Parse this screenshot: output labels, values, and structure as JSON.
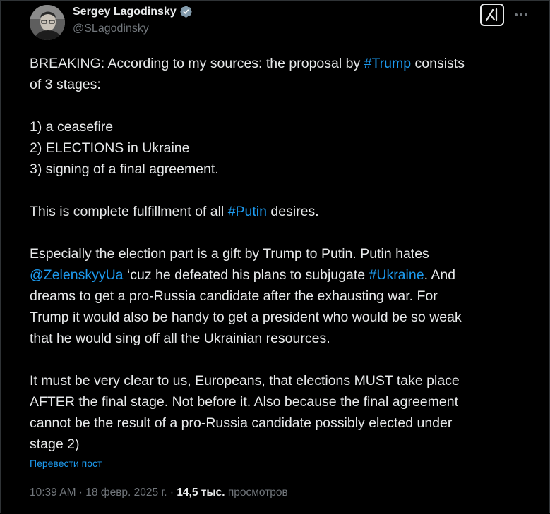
{
  "author": {
    "name": "Sergey Lagodinsky",
    "handle": "@SLagodinsky",
    "verified": true,
    "avatar_icon": "profile-photo"
  },
  "actions": {
    "grok_icon": "grok-icon",
    "more_icon": "more-horizontal-icon"
  },
  "tweet": {
    "p1_a": "BREAKING: According to my sources: the proposal by ",
    "p1_tag": "#Trump",
    "p1_b": " consists",
    "p1_c": "of 3 stages:",
    "list_1": "1) a ceasefire",
    "list_2": "2) ELECTIONS in Ukraine",
    "list_3": "3) signing of a final agreement.",
    "p3_a": "This is complete fulfillment of all ",
    "p3_tag": "#Putin",
    "p3_b": " desires.",
    "p4_l1": "Especially the election part is a gift by Trump to Putin. Putin hates",
    "p4_mention": "@ZelenskyyUa",
    "p4_l2a": " ‘cuz he defeated his plans to subjugate ",
    "p4_tag": "#Ukraine",
    "p4_l2b": ". And",
    "p4_l3": "dreams to get a pro-Russia candidate after the exhausting war. For",
    "p4_l4": "Trump it would also be handy to get a president who would be so weak",
    "p4_l5": "that he would sing off all the Ukrainian resources.",
    "p5_l1": "It must be very clear to us, Europeans, that elections MUST take place",
    "p5_l2": "AFTER the final stage. Not before it. Also because the final agreement",
    "p5_l3": "cannot be the result of a pro-Russia candidate possibly elected under",
    "p5_l4": "stage 2)"
  },
  "translate_label": "Перевести пост",
  "meta": {
    "time": "10:39 AM",
    "date": "18 февр. 2025 г.",
    "separator": " · ",
    "views_count": "14,5 тыс.",
    "views_label": "просмотров"
  },
  "colors": {
    "background": "#000000",
    "text": "#e7e9ea",
    "secondary": "#71767b",
    "link": "#1d9bf0",
    "verified_badge": "#829aab"
  }
}
